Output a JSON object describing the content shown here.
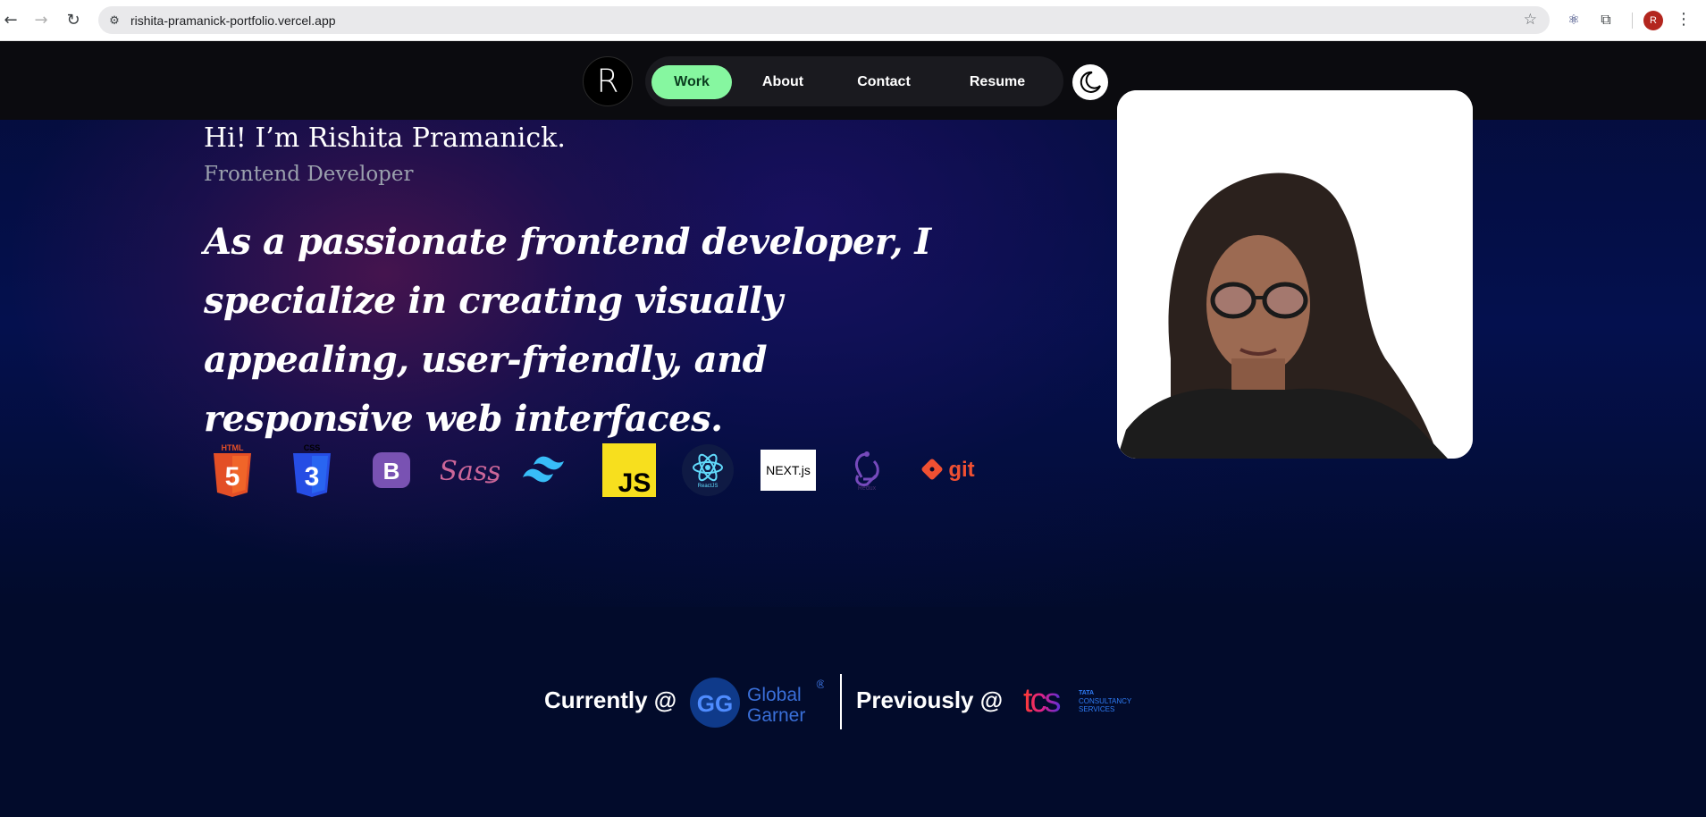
{
  "browser": {
    "url": "rishita-pramanick-portfolio.vercel.app",
    "profile_initial": "R"
  },
  "nav": {
    "logo_letter": "R",
    "items": [
      {
        "label": "Work",
        "active": true
      },
      {
        "label": "About",
        "active": false
      },
      {
        "label": "Contact",
        "active": false
      },
      {
        "label": "Resume",
        "active": false
      }
    ],
    "theme_toggle_icon": "moon-icon"
  },
  "hero": {
    "greeting": "Hi! I’m Rishita Pramanick.",
    "role": "Frontend Developer",
    "tagline": "As a passionate frontend developer, I specialize in creating visually appealing, user-friendly, and responsive web interfaces.",
    "skills": [
      {
        "name": "html5-icon",
        "label": "HTML"
      },
      {
        "name": "css3-icon",
        "label": "CSS"
      },
      {
        "name": "bootstrap-icon",
        "label": "B"
      },
      {
        "name": "sass-icon",
        "label": "Sass"
      },
      {
        "name": "tailwind-icon",
        "label": ""
      },
      {
        "name": "javascript-icon",
        "label": "JS"
      },
      {
        "name": "react-icon",
        "label": "ReactJS"
      },
      {
        "name": "nextjs-icon",
        "label": "NEXT.js"
      },
      {
        "name": "redux-icon",
        "label": "Redux"
      },
      {
        "name": "git-icon",
        "label": "git"
      }
    ]
  },
  "experience": {
    "current_label": "Currently @",
    "current_company": {
      "line1": "Global",
      "line2": "Garner",
      "mark": "®"
    },
    "previous_label": "Previously @",
    "previous_company": {
      "wordmark": "tcs",
      "line1": "TATA",
      "line2": "CONSULTANCY",
      "line3": "SERVICES"
    }
  },
  "colors": {
    "nav_active": "#86f7a0",
    "page_bg": "#020b2b",
    "html5": "#e34f26",
    "css3": "#264de4",
    "bootstrap": "#7952b3",
    "sass": "#cc6699",
    "tailwind": "#38bdf8",
    "javascript": "#f7df1e",
    "react": "#61dafb",
    "redux": "#764abc",
    "git": "#f05032"
  }
}
